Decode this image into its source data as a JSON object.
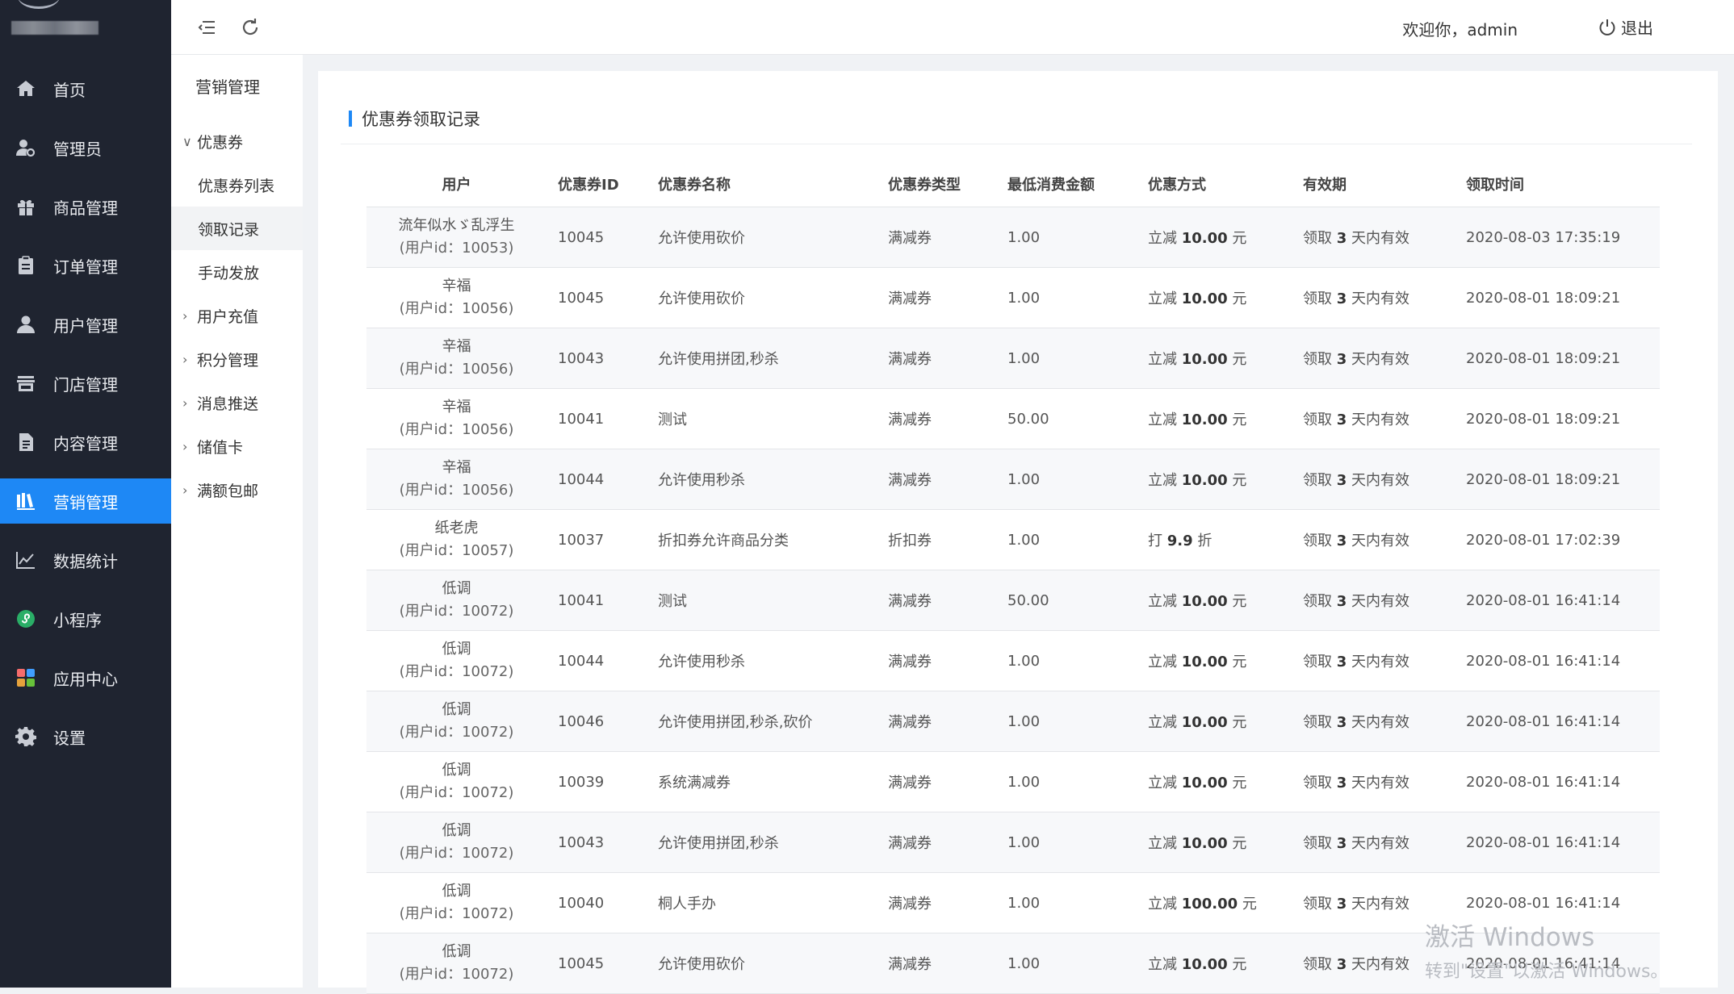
{
  "sidebar": {
    "items": [
      {
        "label": "首页",
        "icon": "home-icon"
      },
      {
        "label": "管理员",
        "icon": "admin-user-icon"
      },
      {
        "label": "商品管理",
        "icon": "gift-icon"
      },
      {
        "label": "订单管理",
        "icon": "clipboard-icon"
      },
      {
        "label": "用户管理",
        "icon": "user-icon"
      },
      {
        "label": "门店管理",
        "icon": "store-icon"
      },
      {
        "label": "内容管理",
        "icon": "document-icon"
      },
      {
        "label": "营销管理",
        "icon": "marketing-icon",
        "active": true
      },
      {
        "label": "数据统计",
        "icon": "line-chart-icon"
      },
      {
        "label": "小程序",
        "icon": "mini-program-icon"
      },
      {
        "label": "应用中心",
        "icon": "app-grid-icon"
      },
      {
        "label": "设置",
        "icon": "gear-icon"
      }
    ],
    "accent_color": "#1e88f5",
    "bg_color": "#1f2430"
  },
  "submenu": {
    "title": "营销管理",
    "items": [
      {
        "label": "优惠券",
        "expanded": true
      },
      {
        "label": "优惠券列表",
        "child": true
      },
      {
        "label": "领取记录",
        "child": true,
        "selected": true
      },
      {
        "label": "手动发放",
        "child": true
      },
      {
        "label": "用户充值"
      },
      {
        "label": "积分管理"
      },
      {
        "label": "消息推送"
      },
      {
        "label": "储值卡"
      },
      {
        "label": "满额包邮"
      }
    ]
  },
  "header": {
    "welcome": "欢迎你，admin",
    "logout": "退出"
  },
  "panel": {
    "title": "优惠券领取记录"
  },
  "table": {
    "columns": [
      "用户",
      "优惠券ID",
      "优惠券名称",
      "优惠券类型",
      "最低消费金额",
      "优惠方式",
      "有效期",
      "领取时间"
    ],
    "rows": [
      {
        "user": "流年似水ゞ乱浮生",
        "uid": "(用户id：10053)",
        "coupon_id": "10045",
        "name": "允许使用砍价",
        "type": "满减券",
        "min": "1.00",
        "way_pre": "立减 ",
        "way_num": "10.00",
        "way_post": " 元",
        "valid_pre": "领取 ",
        "valid_num": "3",
        "valid_post": " 天内有效",
        "time": "2020-08-03 17:35:19"
      },
      {
        "user": "辛福",
        "uid": "(用户id：10056)",
        "coupon_id": "10045",
        "name": "允许使用砍价",
        "type": "满减券",
        "min": "1.00",
        "way_pre": "立减 ",
        "way_num": "10.00",
        "way_post": " 元",
        "valid_pre": "领取 ",
        "valid_num": "3",
        "valid_post": " 天内有效",
        "time": "2020-08-01 18:09:21"
      },
      {
        "user": "辛福",
        "uid": "(用户id：10056)",
        "coupon_id": "10043",
        "name": "允许使用拼团,秒杀",
        "type": "满减券",
        "min": "1.00",
        "way_pre": "立减 ",
        "way_num": "10.00",
        "way_post": " 元",
        "valid_pre": "领取 ",
        "valid_num": "3",
        "valid_post": " 天内有效",
        "time": "2020-08-01 18:09:21"
      },
      {
        "user": "辛福",
        "uid": "(用户id：10056)",
        "coupon_id": "10041",
        "name": "测试",
        "type": "满减券",
        "min": "50.00",
        "way_pre": "立减 ",
        "way_num": "10.00",
        "way_post": " 元",
        "valid_pre": "领取 ",
        "valid_num": "3",
        "valid_post": " 天内有效",
        "time": "2020-08-01 18:09:21"
      },
      {
        "user": "辛福",
        "uid": "(用户id：10056)",
        "coupon_id": "10044",
        "name": "允许使用秒杀",
        "type": "满减券",
        "min": "1.00",
        "way_pre": "立减 ",
        "way_num": "10.00",
        "way_post": " 元",
        "valid_pre": "领取 ",
        "valid_num": "3",
        "valid_post": " 天内有效",
        "time": "2020-08-01 18:09:21"
      },
      {
        "user": "纸老虎",
        "uid": "(用户id：10057)",
        "coupon_id": "10037",
        "name": "折扣券允许商品分类",
        "type": "折扣券",
        "min": "1.00",
        "way_pre": "打 ",
        "way_num": "9.9",
        "way_post": " 折",
        "valid_pre": "领取 ",
        "valid_num": "3",
        "valid_post": " 天内有效",
        "time": "2020-08-01 17:02:39"
      },
      {
        "user": "低调",
        "uid": "(用户id：10072)",
        "coupon_id": "10041",
        "name": "测试",
        "type": "满减券",
        "min": "50.00",
        "way_pre": "立减 ",
        "way_num": "10.00",
        "way_post": " 元",
        "valid_pre": "领取 ",
        "valid_num": "3",
        "valid_post": " 天内有效",
        "time": "2020-08-01 16:41:14"
      },
      {
        "user": "低调",
        "uid": "(用户id：10072)",
        "coupon_id": "10044",
        "name": "允许使用秒杀",
        "type": "满减券",
        "min": "1.00",
        "way_pre": "立减 ",
        "way_num": "10.00",
        "way_post": " 元",
        "valid_pre": "领取 ",
        "valid_num": "3",
        "valid_post": " 天内有效",
        "time": "2020-08-01 16:41:14"
      },
      {
        "user": "低调",
        "uid": "(用户id：10072)",
        "coupon_id": "10046",
        "name": "允许使用拼团,秒杀,砍价",
        "type": "满减券",
        "min": "1.00",
        "way_pre": "立减 ",
        "way_num": "10.00",
        "way_post": " 元",
        "valid_pre": "领取 ",
        "valid_num": "3",
        "valid_post": " 天内有效",
        "time": "2020-08-01 16:41:14"
      },
      {
        "user": "低调",
        "uid": "(用户id：10072)",
        "coupon_id": "10039",
        "name": "系统满减券",
        "type": "满减券",
        "min": "1.00",
        "way_pre": "立减 ",
        "way_num": "10.00",
        "way_post": " 元",
        "valid_pre": "领取 ",
        "valid_num": "3",
        "valid_post": " 天内有效",
        "time": "2020-08-01 16:41:14"
      },
      {
        "user": "低调",
        "uid": "(用户id：10072)",
        "coupon_id": "10043",
        "name": "允许使用拼团,秒杀",
        "type": "满减券",
        "min": "1.00",
        "way_pre": "立减 ",
        "way_num": "10.00",
        "way_post": " 元",
        "valid_pre": "领取 ",
        "valid_num": "3",
        "valid_post": " 天内有效",
        "time": "2020-08-01 16:41:14"
      },
      {
        "user": "低调",
        "uid": "(用户id：10072)",
        "coupon_id": "10040",
        "name": "桐人手办",
        "type": "满减券",
        "min": "1.00",
        "way_pre": "立减 ",
        "way_num": "100.00",
        "way_post": " 元",
        "valid_pre": "领取 ",
        "valid_num": "3",
        "valid_post": " 天内有效",
        "time": "2020-08-01 16:41:14"
      },
      {
        "user": "低调",
        "uid": "(用户id：10072)",
        "coupon_id": "10045",
        "name": "允许使用砍价",
        "type": "满减券",
        "min": "1.00",
        "way_pre": "立减 ",
        "way_num": "10.00",
        "way_post": " 元",
        "valid_pre": "领取 ",
        "valid_num": "3",
        "valid_post": " 天内有效",
        "time": "2020-08-01 16:41:14"
      }
    ]
  },
  "watermark": {
    "line1": "激活 Windows",
    "line2": "转到\"设置\"以激活 Windows。"
  }
}
